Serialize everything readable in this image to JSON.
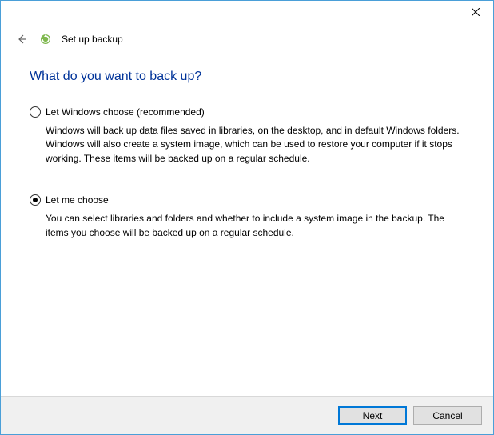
{
  "header": {
    "title": "Set up backup"
  },
  "main": {
    "heading": "What do you want to back up?",
    "options": [
      {
        "label": "Let Windows choose (recommended)",
        "description": "Windows will back up data files saved in libraries, on the desktop, and in default Windows folders. Windows will also create a system image, which can be used to restore your computer if it stops working. These items will be backed up on a regular schedule.",
        "checked": false
      },
      {
        "label": "Let me choose",
        "description": "You can select libraries and folders and whether to include a system image in the backup. The items you choose will be backed up on a regular schedule.",
        "checked": true
      }
    ]
  },
  "footer": {
    "next_label": "Next",
    "cancel_label": "Cancel"
  }
}
